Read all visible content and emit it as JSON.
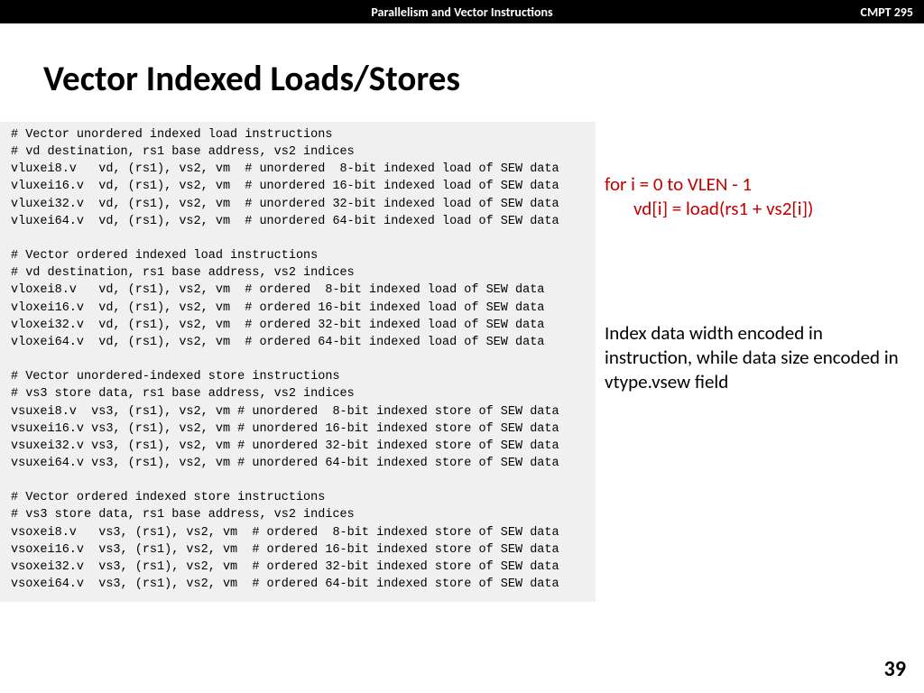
{
  "header": {
    "center": "Parallelism and Vector Instructions",
    "right": "CMPT 295"
  },
  "title": "Vector Indexed Loads/Stores",
  "code": "# Vector unordered indexed load instructions\n# vd destination, rs1 base address, vs2 indices\nvluxei8.v   vd, (rs1), vs2, vm  # unordered  8-bit indexed load of SEW data\nvluxei16.v  vd, (rs1), vs2, vm  # unordered 16-bit indexed load of SEW data\nvluxei32.v  vd, (rs1), vs2, vm  # unordered 32-bit indexed load of SEW data\nvluxei64.v  vd, (rs1), vs2, vm  # unordered 64-bit indexed load of SEW data\n\n# Vector ordered indexed load instructions\n# vd destination, rs1 base address, vs2 indices\nvloxei8.v   vd, (rs1), vs2, vm  # ordered  8-bit indexed load of SEW data\nvloxei16.v  vd, (rs1), vs2, vm  # ordered 16-bit indexed load of SEW data\nvloxei32.v  vd, (rs1), vs2, vm  # ordered 32-bit indexed load of SEW data\nvloxei64.v  vd, (rs1), vs2, vm  # ordered 64-bit indexed load of SEW data\n\n# Vector unordered-indexed store instructions\n# vs3 store data, rs1 base address, vs2 indices\nvsuxei8.v  vs3, (rs1), vs2, vm # unordered  8-bit indexed store of SEW data\nvsuxei16.v vs3, (rs1), vs2, vm # unordered 16-bit indexed store of SEW data\nvsuxei32.v vs3, (rs1), vs2, vm # unordered 32-bit indexed store of SEW data\nvsuxei64.v vs3, (rs1), vs2, vm # unordered 64-bit indexed store of SEW data\n\n# Vector ordered indexed store instructions\n# vs3 store data, rs1 base address, vs2 indices\nvsoxei8.v   vs3, (rs1), vs2, vm  # ordered  8-bit indexed store of SEW data\nvsoxei16.v  vs3, (rs1), vs2, vm  # ordered 16-bit indexed store of SEW data\nvsoxei32.v  vs3, (rs1), vs2, vm  # ordered 32-bit indexed store of SEW data\nvsoxei64.v  vs3, (rs1), vs2, vm  # ordered 64-bit indexed store of SEW data",
  "pseudo": {
    "line1": "for i = 0 to VLEN - 1",
    "line2": "vd[i] = load(rs1 + vs2[i])"
  },
  "note": "Index data width encoded in instruction, while data size encoded in vtype.vsew field",
  "pageNumber": "39"
}
